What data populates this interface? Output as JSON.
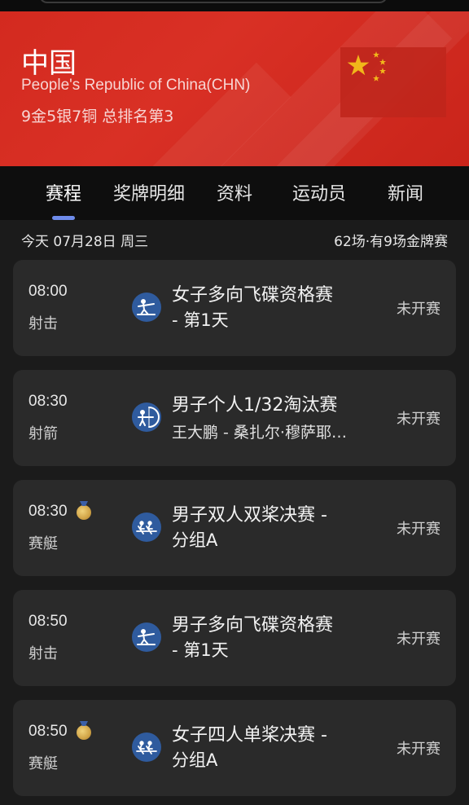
{
  "header": {
    "country": "中国",
    "full_name": "People's Republic of China(CHN)",
    "medal_summary": "9金5银7铜 总排名第3",
    "flag_icon": "china-flag-icon",
    "colors": {
      "header_red": "#d93025",
      "flag_red": "#c0261c",
      "flag_star": "#f5c518"
    }
  },
  "tabs": [
    {
      "label": "赛程",
      "active": true
    },
    {
      "label": "奖牌明细",
      "active": false
    },
    {
      "label": "资料",
      "active": false
    },
    {
      "label": "运动员",
      "active": false
    },
    {
      "label": "新闻",
      "active": false
    }
  ],
  "date_bar": {
    "date": "今天 07月28日 周三",
    "count": "62场·有9场金牌赛"
  },
  "events": [
    {
      "time": "08:00",
      "sport": "射击",
      "icon": "shooting-icon",
      "gold_medal_event": false,
      "title_line1": "女子多向飞碟资格赛",
      "title_line2": "- 第1天",
      "line2_style": "title",
      "status": "未开赛"
    },
    {
      "time": "08:30",
      "sport": "射箭",
      "icon": "archery-icon",
      "gold_medal_event": false,
      "title_line1": "男子个人1/32淘汰赛",
      "title_line2": "王大鹏 - 桑扎尔·穆萨耶…",
      "line2_style": "sub",
      "status": "未开赛"
    },
    {
      "time": "08:30",
      "sport": "赛艇",
      "icon": "rowing-icon",
      "gold_medal_event": true,
      "title_line1": "男子双人双桨决赛 -",
      "title_line2": "分组A",
      "line2_style": "title",
      "status": "未开赛"
    },
    {
      "time": "08:50",
      "sport": "射击",
      "icon": "shooting-icon",
      "gold_medal_event": false,
      "title_line1": "男子多向飞碟资格赛",
      "title_line2": "- 第1天",
      "line2_style": "title",
      "status": "未开赛"
    },
    {
      "time": "08:50",
      "sport": "赛艇",
      "icon": "rowing-icon",
      "gold_medal_event": true,
      "title_line1": "女子四人单桨决赛 -",
      "title_line2": "分组A",
      "line2_style": "title",
      "status": "未开赛"
    }
  ],
  "colors": {
    "tab_indicator": "#6e8bea",
    "card_bg": "#2a2a2a",
    "sport_icon_bg": "#2f5b9e",
    "gold_medal": "#d1a447"
  }
}
